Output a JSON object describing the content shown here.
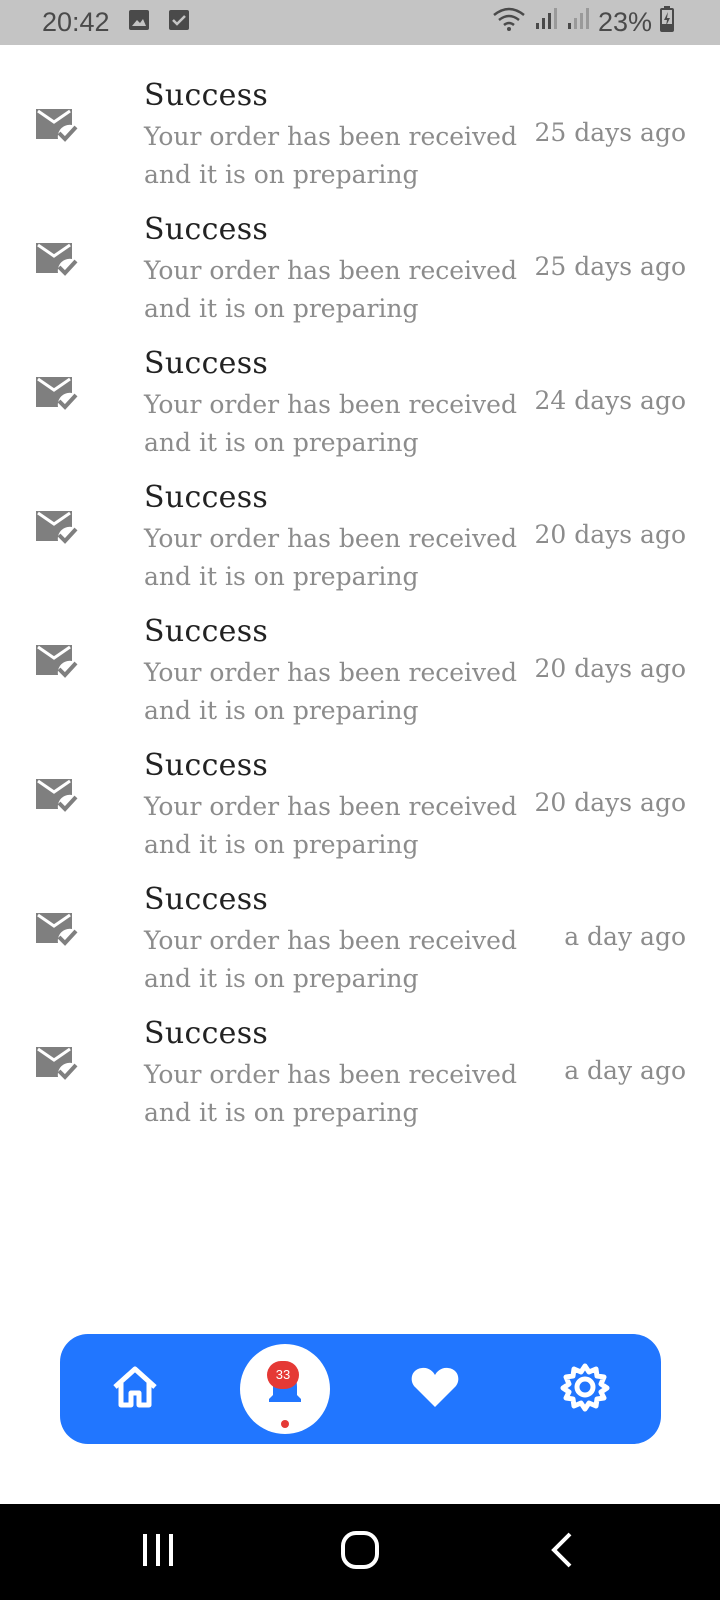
{
  "status_bar": {
    "time": "20:42",
    "battery": "23%",
    "left_icons": [
      "image-icon",
      "checkbox-icon"
    ],
    "right_icons": [
      "wifi-icon",
      "signal-icon",
      "signal-icon",
      "battery-icon"
    ]
  },
  "notifications": [
    {
      "title": "Success",
      "body": "Your order has been received and it is on preparing",
      "time": "25 days ago",
      "icon": "mail-check-icon"
    },
    {
      "title": "Success",
      "body": "Your order has been received and it is on preparing",
      "time": "25 days ago",
      "icon": "mail-check-icon"
    },
    {
      "title": "Success",
      "body": "Your order has been received and it is on preparing",
      "time": "24 days ago",
      "icon": "mail-check-icon"
    },
    {
      "title": "Success",
      "body": "Your order has been received and it is on preparing",
      "time": "20 days ago",
      "icon": "mail-check-icon"
    },
    {
      "title": "Success",
      "body": "Your order has been received and it is on preparing",
      "time": "20 days ago",
      "icon": "mail-check-icon"
    },
    {
      "title": "Success",
      "body": "Your order has been received and it is on preparing",
      "time": "20 days ago",
      "icon": "mail-check-icon"
    },
    {
      "title": "Success",
      "body": "Your order has been received and it is on preparing",
      "time": "a day ago",
      "icon": "mail-check-icon"
    },
    {
      "title": "Success",
      "body": "Your order has been received and it is on preparing",
      "time": "a day ago",
      "icon": "mail-check-icon"
    }
  ],
  "bottom_nav": {
    "items": [
      "home-icon",
      "bell-icon",
      "heart-icon",
      "gear-icon"
    ],
    "active": "bell-icon",
    "badge_count": "33",
    "accent_color": "#2176ff"
  },
  "system_nav": [
    "recent-apps-icon",
    "home-circle-icon",
    "back-icon"
  ]
}
